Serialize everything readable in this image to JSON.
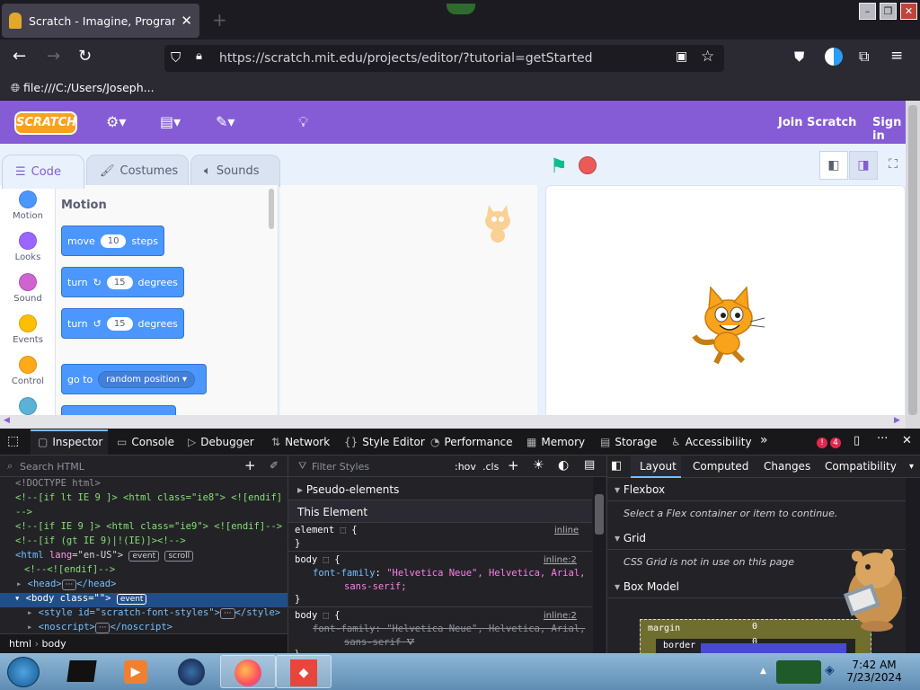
{
  "browser": {
    "tab_title": "Scratch - Imagine, Program, Sh",
    "url": "https://scratch.mit.edu/projects/editor/?tutorial=getStarted",
    "bookmark": "file:///C:/Users/Joseph..."
  },
  "scratch": {
    "logo": "SCRATCH",
    "join": "Join Scratch",
    "signin": "Sign in",
    "tabs": [
      "Code",
      "Costumes",
      "Sounds"
    ],
    "categories": [
      {
        "label": "Motion",
        "color": "#4c97ff"
      },
      {
        "label": "Looks",
        "color": "#9966ff"
      },
      {
        "label": "Sound",
        "color": "#cf63cf"
      },
      {
        "label": "Events",
        "color": "#ffbf00"
      },
      {
        "label": "Control",
        "color": "#ffab19"
      }
    ],
    "palette_title": "Motion",
    "blocks": {
      "move": "move",
      "move_val": "10",
      "steps": "steps",
      "turn1": "turn",
      "turn1_val": "15",
      "deg1": "degrees",
      "turn2": "turn",
      "turn2_val": "15",
      "deg2": "degrees",
      "goto": "go to",
      "goto_val": "random position"
    }
  },
  "devtools": {
    "tabs": [
      "Inspector",
      "Console",
      "Debugger",
      "Network",
      "Style Editor",
      "Performance",
      "Memory",
      "Storage",
      "Accessibility"
    ],
    "errors": "4",
    "search_placeholder": "Search HTML",
    "filter_placeholder": "Filter Styles",
    "hov": ":hov",
    "cls": ".cls",
    "html_lines": {
      "l1": "<!DOCTYPE html>",
      "l2a": "<!--[if lt IE 9 ]> <html class=\"ie8\"> <![endif]",
      "l2b": "-->",
      "l3": "<!--[if IE 9 ]> <html class=\"ie9\"> <![endif]-->",
      "l4": "<!--[if (gt IE 9)|!(IE)]><!-->",
      "l5_tag": "<html",
      "l5_attr": "lang",
      "l5_val": "=\"en-US\">",
      "l5_b1": "event",
      "l5_b2": "scroll",
      "l6": "<!--<![endif]-->",
      "l7": "<head>",
      "l7b": "</head>",
      "l8_tag": "<body",
      "l8_attr": "class",
      "l8_val": "=\"\">",
      "l8_b": "event",
      "l9": "<style id=\"scratch-font-styles\">",
      "l9b": "</style>",
      "l10": "<noscript>",
      "l10b": "</noscript>"
    },
    "breadcrumb": [
      "html",
      "body"
    ],
    "pseudo": "Pseudo-elements",
    "this_element": "This Element",
    "rules": {
      "r1_sel": "element",
      "r1_src": "inline",
      "r2_sel": "body",
      "r2_src": "inline:2",
      "r2_prop": "font-family",
      "r2_val": "\"Helvetica Neue\", Helvetica, Arial,",
      "r2_val2": "sans-serif;",
      "r3_sel": "body",
      "r3_src": "inline:2",
      "r3_prop": "font-family",
      "r3_val": "\"Helvetica Neue\", Helvetica, Arial,",
      "r3_val2": "sans-serif"
    },
    "layout_tabs": [
      "Layout",
      "Computed",
      "Changes",
      "Compatibility"
    ],
    "flexbox": "Flexbox",
    "flexbox_msg": "Select a Flex container or item to continue.",
    "grid": "Grid",
    "grid_msg": "CSS Grid is not in use on this page",
    "boxmodel": "Box Model",
    "margin": "margin",
    "border": "border",
    "zero": "0"
  },
  "taskbar": {
    "time": "7:42 AM",
    "date": "7/23/2024"
  }
}
